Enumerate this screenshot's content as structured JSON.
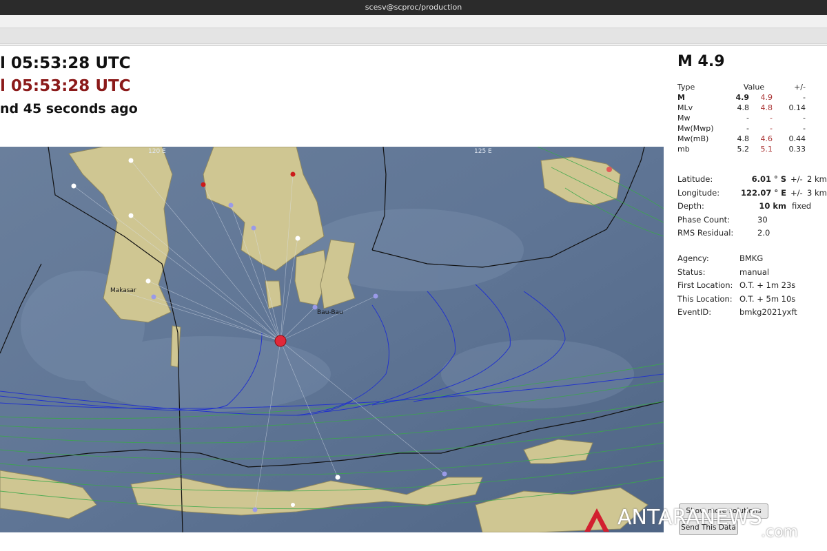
{
  "window": {
    "title": "scesv@scproc/production"
  },
  "origin": {
    "time_line_1": "l 05:53:28 UTC",
    "time_line_2": "l 05:53:28 UTC",
    "ago": "nd 45 seconds ago"
  },
  "map": {
    "grid_labels": [
      "120 E",
      "125 E"
    ],
    "place_labels": [
      "Makasar",
      "Bau-Bau"
    ],
    "colors": {
      "sea": "#5d7391",
      "land": "#cfc796",
      "epicenter": "#e1283a",
      "blue_contour": "#2233cc",
      "green_contour": "#3aa84a"
    }
  },
  "magnitude": {
    "headline": "M 4.9",
    "headers": {
      "type": "Type",
      "value": "Value",
      "pm": "+/-"
    },
    "rows": [
      {
        "type": "M",
        "v1": "4.9",
        "v2": "4.9",
        "err": "-"
      },
      {
        "type": "MLv",
        "v1": "4.8",
        "v2": "4.8",
        "err": "0.14"
      },
      {
        "type": "Mw",
        "v1": "-",
        "v2": "-",
        "err": "-"
      },
      {
        "type": "Mw(Mwp)",
        "v1": "-",
        "v2": "-",
        "err": "-"
      },
      {
        "type": "Mw(mB)",
        "v1": "4.8",
        "v2": "4.6",
        "err": "0.44"
      },
      {
        "type": "mb",
        "v1": "5.2",
        "v2": "5.1",
        "err": "0.33"
      }
    ]
  },
  "location": {
    "latitude_label": "Latitude:",
    "latitude_value": "6.01 ° S",
    "latitude_pm": "+/-",
    "latitude_err": "2 km",
    "longitude_label": "Longitude:",
    "longitude_value": "122.07 ° E",
    "longitude_pm": "+/-",
    "longitude_err": "3 km",
    "depth_label": "Depth:",
    "depth_value": "10 km",
    "depth_note": "fixed",
    "phase_label": "Phase Count:",
    "phase_value": "30",
    "rms_label": "RMS Residual:",
    "rms_value": "2.0"
  },
  "event": {
    "agency_label": "Agency:",
    "agency_value": "BMKG",
    "status_label": "Status:",
    "status_value": "manual",
    "first_label": "First Location:",
    "first_value": "O.T. + 1m 23s",
    "this_label": "This Location:",
    "this_value": "O.T. + 5m 10s",
    "id_label": "EventID:",
    "id_value": "bmkg2021yxft"
  },
  "buttons": {
    "show_solution": "Show more solutions",
    "send": "Send This Data"
  },
  "watermark": {
    "brand": "ANTARANEWS",
    "suffix": ".com"
  }
}
